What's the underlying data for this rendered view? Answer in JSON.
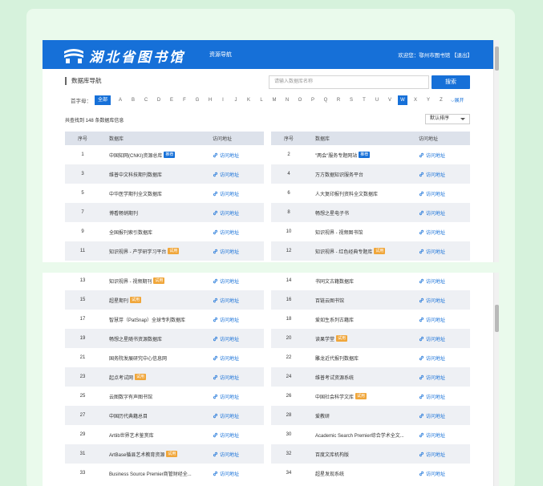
{
  "header": {
    "logo_text": "湖北省图书馆",
    "nav_link": "资源导航",
    "welcome": "欢迎您：鄂州市图书馆 【退出】"
  },
  "page": {
    "title": "数据库导航",
    "search_placeholder": "请输入数据库名称",
    "search_button": "搜索",
    "alpha_label": "首字母：",
    "alpha_all": "全部",
    "letters": [
      "A",
      "B",
      "C",
      "D",
      "E",
      "F",
      "G",
      "H",
      "I",
      "J",
      "K",
      "L",
      "M",
      "N",
      "O",
      "P",
      "Q",
      "R",
      "S",
      "T",
      "U",
      "V",
      "W",
      "X",
      "Y",
      "Z"
    ],
    "active_letter": "W",
    "expand_label": "展开",
    "count_text": "共查找到 148 条数据库信息",
    "sort_value": "默认排序"
  },
  "table": {
    "col_no": "序号",
    "col_name": "数据库",
    "col_link": "访问地址",
    "link_label": "访问地址",
    "left_top": [
      {
        "no": "1",
        "name": "中国知网(CNKI)资源总库",
        "tag": "推荐",
        "tag_color": "#1670d8"
      },
      {
        "no": "3",
        "name": "维普中文科技期刊数据库",
        "tag": "",
        "tag_color": ""
      },
      {
        "no": "5",
        "name": "中华医学期刊全文数据库",
        "tag": "",
        "tag_color": ""
      },
      {
        "no": "7",
        "name": "博看畅销期刊",
        "tag": "",
        "tag_color": ""
      },
      {
        "no": "9",
        "name": "全国报刊索引数据库",
        "tag": "",
        "tag_color": ""
      },
      {
        "no": "11",
        "name": "知识视界 - 产学研学习平台",
        "tag": "试用",
        "tag_color": "#f0a63a"
      }
    ],
    "right_top": [
      {
        "no": "2",
        "name": "\"两会\"服务专题网站",
        "tag": "推荐",
        "tag_color": "#1670d8"
      },
      {
        "no": "4",
        "name": "万方数据知识服务平台",
        "tag": "",
        "tag_color": ""
      },
      {
        "no": "6",
        "name": "人大复印报刊资料全文数据库",
        "tag": "",
        "tag_color": ""
      },
      {
        "no": "8",
        "name": "畅想之星电子书",
        "tag": "",
        "tag_color": ""
      },
      {
        "no": "10",
        "name": "知识视界 - 视频图书馆",
        "tag": "",
        "tag_color": ""
      },
      {
        "no": "12",
        "name": "知识视界 - 红色经典专题库",
        "tag": "试用",
        "tag_color": "#f0a63a"
      }
    ],
    "left_bottom": [
      {
        "no": "13",
        "name": "知识视界 - 视频期刊",
        "tag": "试用",
        "tag_color": "#f0a63a"
      },
      {
        "no": "15",
        "name": "超星期刊",
        "tag": "试用",
        "tag_color": "#f0a63a"
      },
      {
        "no": "17",
        "name": "智慧芽（PatSnap）全球专利数据库",
        "tag": "",
        "tag_color": ""
      },
      {
        "no": "19",
        "name": "畅想之星随书资源数据库",
        "tag": "",
        "tag_color": ""
      },
      {
        "no": "21",
        "name": "国务院发展研究中心信息网",
        "tag": "",
        "tag_color": ""
      },
      {
        "no": "23",
        "name": "起点考试网",
        "tag": "试用",
        "tag_color": "#f0a63a"
      },
      {
        "no": "25",
        "name": "云图数字有声图书馆",
        "tag": "",
        "tag_color": ""
      },
      {
        "no": "27",
        "name": "中国历代典籍总目",
        "tag": "",
        "tag_color": ""
      },
      {
        "no": "29",
        "name": "Artlib世界艺术鉴赏库",
        "tag": "",
        "tag_color": ""
      },
      {
        "no": "31",
        "name": "ArtBase循县艺术教育资源",
        "tag": "试用",
        "tag_color": "#f0a63a"
      },
      {
        "no": "33",
        "name": "Business Source Premier商管财经全...",
        "tag": "",
        "tag_color": ""
      }
    ],
    "right_bottom": [
      {
        "no": "14",
        "name": "书同文古籍数据库",
        "tag": "",
        "tag_color": ""
      },
      {
        "no": "16",
        "name": "百链云图书馆",
        "tag": "",
        "tag_color": ""
      },
      {
        "no": "18",
        "name": "爱如生系列古籍库",
        "tag": "",
        "tag_color": ""
      },
      {
        "no": "20",
        "name": "读果学堂",
        "tag": "试用",
        "tag_color": "#f0a63a"
      },
      {
        "no": "22",
        "name": "雕龙近代报刊数据库",
        "tag": "",
        "tag_color": ""
      },
      {
        "no": "24",
        "name": "维普考试资源系统",
        "tag": "",
        "tag_color": ""
      },
      {
        "no": "26",
        "name": "中国社会科学文库",
        "tag": "试用",
        "tag_color": "#f0a63a"
      },
      {
        "no": "28",
        "name": "爱教研",
        "tag": "",
        "tag_color": ""
      },
      {
        "no": "30",
        "name": "Academic Search Premier综合学术全文...",
        "tag": "",
        "tag_color": ""
      },
      {
        "no": "32",
        "name": "百度文库机构版",
        "tag": "",
        "tag_color": ""
      },
      {
        "no": "34",
        "name": "超星发现系统",
        "tag": "",
        "tag_color": ""
      }
    ]
  },
  "colors": {
    "primary": "#1670d8",
    "tag_trial": "#f0a63a",
    "page_bg": "#d6f2dc"
  }
}
